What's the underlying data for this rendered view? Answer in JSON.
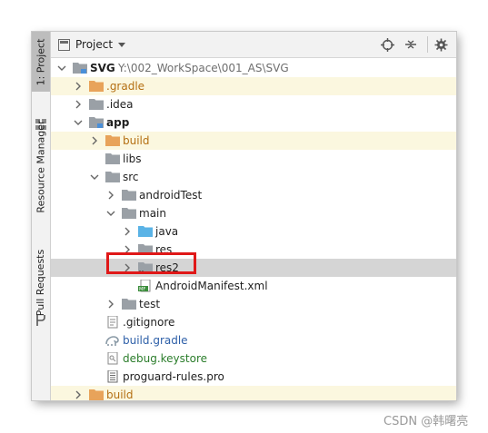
{
  "side_tabs": [
    {
      "label": "1: Project"
    },
    {
      "label": "Resource Manager"
    },
    {
      "label": "Pull Requests"
    }
  ],
  "toolbar": {
    "view_label": "Project",
    "icons": [
      "crosshair-icon",
      "collapse-all-icon",
      "gear-icon",
      "minimize-icon"
    ]
  },
  "tree": {
    "root_name": "SVG",
    "root_path": "Y:\\002_WorkSpace\\001_AS\\SVG",
    "items": [
      {
        "label": ".gradle"
      },
      {
        "label": ".idea"
      },
      {
        "label": "app"
      },
      {
        "label": "build"
      },
      {
        "label": "libs"
      },
      {
        "label": "src"
      },
      {
        "label": "androidTest"
      },
      {
        "label": "main"
      },
      {
        "label": "java"
      },
      {
        "label": "res"
      },
      {
        "label": "res2"
      },
      {
        "label": "AndroidManifest.xml"
      },
      {
        "label": "test"
      },
      {
        "label": ".gitignore"
      },
      {
        "label": "build.gradle"
      },
      {
        "label": "debug.keystore"
      },
      {
        "label": "proguard-rules.pro"
      },
      {
        "label": "build"
      }
    ]
  },
  "manifest_badge": "MF",
  "watermark": "CSDN @韩曙亮",
  "colors": {
    "selected_row": "#d5d5d5",
    "excluded_row": "#fbf7df",
    "highlight_box": "#e01818",
    "excluded_folder": "#e8a35a",
    "source_folder": "#5ab3e6",
    "folder": "#9aa0a6"
  }
}
